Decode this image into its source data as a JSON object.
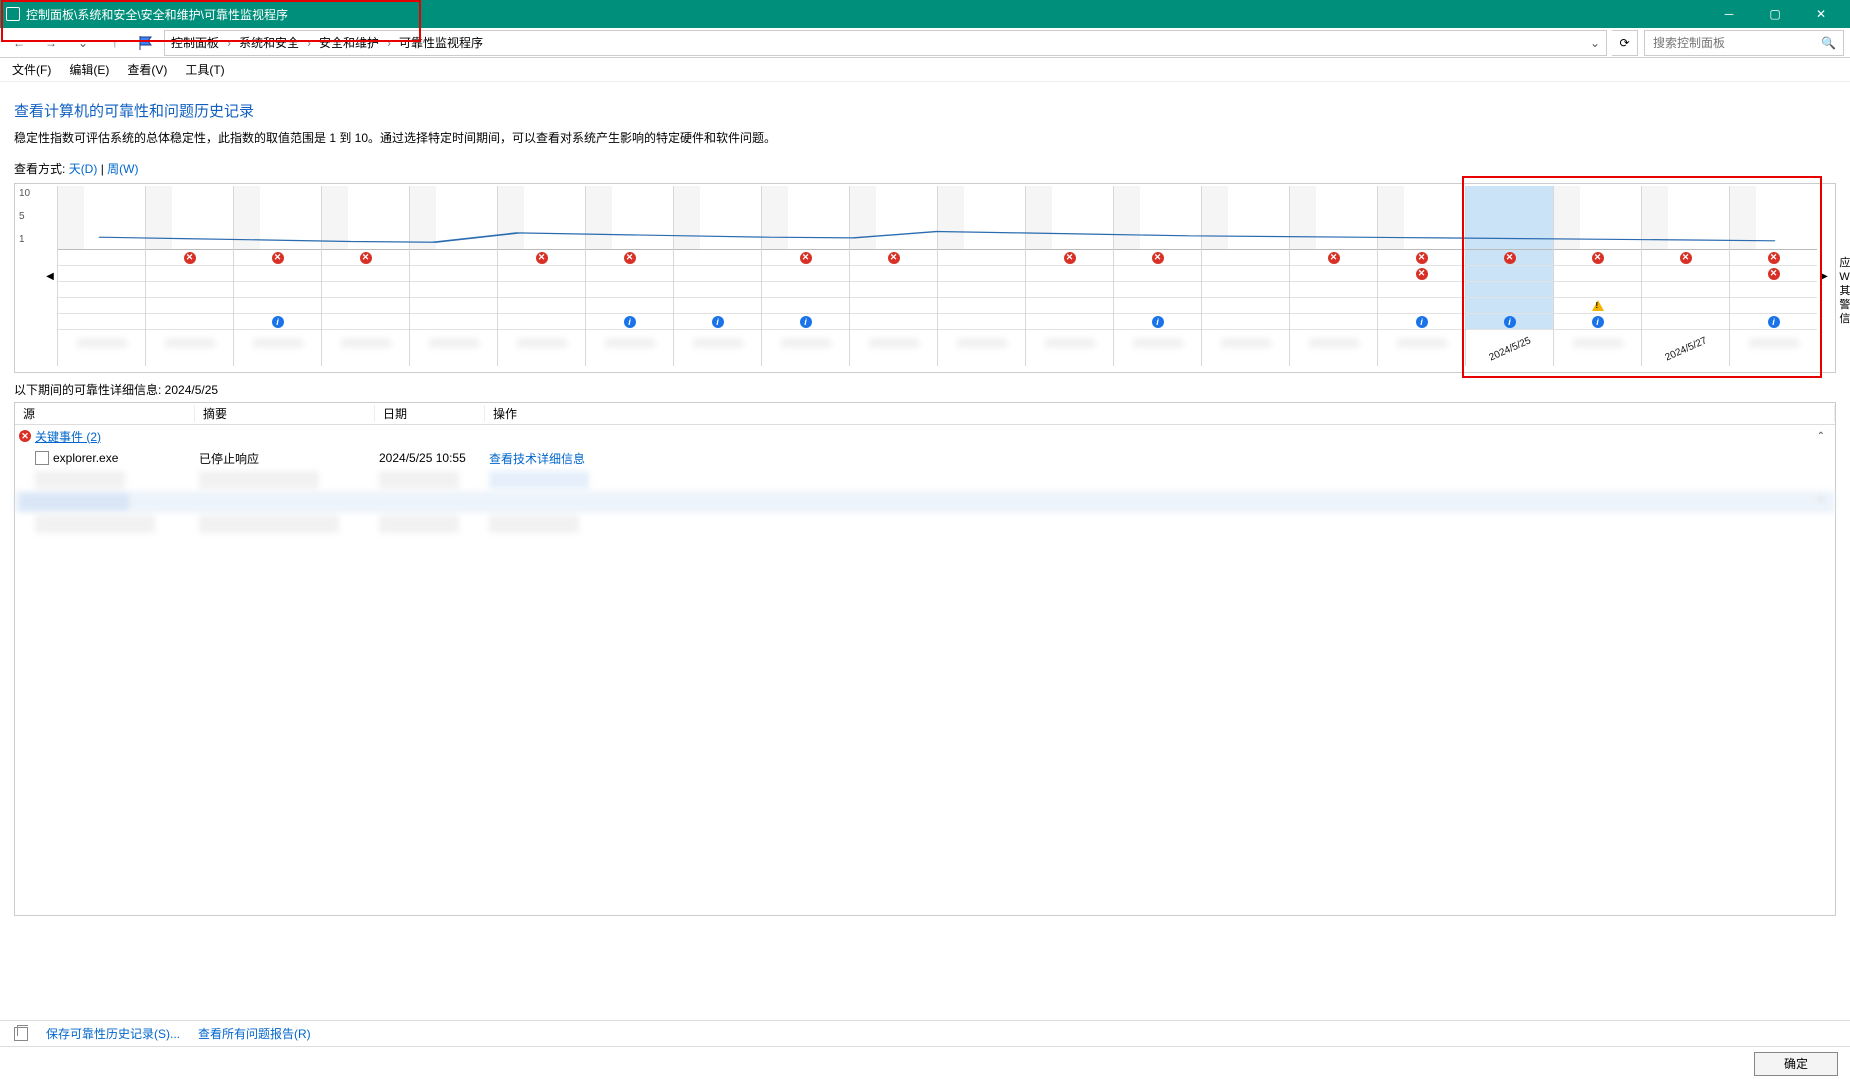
{
  "window": {
    "title": "控制面板\\系统和安全\\安全和维护\\可靠性监视程序"
  },
  "breadcrumb": {
    "items": [
      "控制面板",
      "系统和安全",
      "安全和维护",
      "可靠性监视程序"
    ]
  },
  "search": {
    "placeholder": "搜索控制面板"
  },
  "menubar": {
    "file": "文件(F)",
    "edit": "编辑(E)",
    "view": "查看(V)",
    "tools": "工具(T)"
  },
  "page": {
    "heading": "查看计算机的可靠性和问题历史记录",
    "description": "稳定性指数可评估系统的总体稳定性，此指数的取值范围是 1 到 10。通过选择特定时间期间，可以查看对系统产生影响的特定硬件和软件问题。",
    "view_by_label": "查看方式:",
    "view_by_day": "天(D)",
    "view_by_week": "周(W)",
    "separator": " | "
  },
  "chart_data": {
    "type": "line",
    "ylim": [
      1,
      10
    ],
    "ytick_labels": [
      "10",
      "5",
      "1"
    ],
    "row_labels": [
      "应用程序故障",
      "Windows 故障",
      "其他故障",
      "警告",
      "信息"
    ],
    "dates_visible": [
      "2024/5/25",
      "2024/5/27"
    ],
    "line_y": [
      2.8,
      2.6,
      2.4,
      2.2,
      2.1,
      3.4,
      3.2,
      3.0,
      2.8,
      2.7,
      3.6,
      3.4,
      3.2,
      3.0,
      2.9,
      2.8,
      2.7,
      2.6,
      2.5,
      2.4,
      2.3
    ],
    "columns": [
      {
        "app": false,
        "win": false,
        "other": false,
        "warn": false,
        "info": false,
        "date": ""
      },
      {
        "app": true,
        "win": false,
        "other": false,
        "warn": false,
        "info": false,
        "date": ""
      },
      {
        "app": true,
        "win": false,
        "other": false,
        "warn": false,
        "info": true,
        "date": ""
      },
      {
        "app": true,
        "win": false,
        "other": false,
        "warn": false,
        "info": false,
        "date": ""
      },
      {
        "app": false,
        "win": false,
        "other": false,
        "warn": false,
        "info": false,
        "date": ""
      },
      {
        "app": true,
        "win": false,
        "other": false,
        "warn": false,
        "info": false,
        "date": ""
      },
      {
        "app": true,
        "win": false,
        "other": false,
        "warn": false,
        "info": true,
        "date": ""
      },
      {
        "app": false,
        "win": false,
        "other": false,
        "warn": false,
        "info": true,
        "date": ""
      },
      {
        "app": true,
        "win": false,
        "other": false,
        "warn": false,
        "info": true,
        "date": ""
      },
      {
        "app": true,
        "win": false,
        "other": false,
        "warn": false,
        "info": false,
        "date": ""
      },
      {
        "app": false,
        "win": false,
        "other": false,
        "warn": false,
        "info": false,
        "date": ""
      },
      {
        "app": true,
        "win": false,
        "other": false,
        "warn": false,
        "info": false,
        "date": ""
      },
      {
        "app": true,
        "win": false,
        "other": false,
        "warn": false,
        "info": true,
        "date": ""
      },
      {
        "app": false,
        "win": false,
        "other": false,
        "warn": false,
        "info": false,
        "date": ""
      },
      {
        "app": true,
        "win": false,
        "other": false,
        "warn": false,
        "info": false,
        "date": ""
      },
      {
        "app": true,
        "win": true,
        "other": false,
        "warn": false,
        "info": true,
        "date": ""
      },
      {
        "app": true,
        "win": false,
        "other": false,
        "warn": false,
        "info": true,
        "date": "2024/5/25",
        "highlight": true
      },
      {
        "app": true,
        "win": false,
        "other": false,
        "warn": true,
        "info": true,
        "date": ""
      },
      {
        "app": true,
        "win": false,
        "other": false,
        "warn": false,
        "info": false,
        "date": "2024/5/27"
      },
      {
        "app": true,
        "win": true,
        "other": false,
        "warn": false,
        "info": true,
        "date": ""
      }
    ]
  },
  "details": {
    "period_label": "以下期间的可靠性详细信息: 2024/5/25",
    "columns": {
      "source": "源",
      "summary": "摘要",
      "date": "日期",
      "action": "操作"
    },
    "group_critical": "关键事件 (2)",
    "rows": [
      {
        "source": "explorer.exe",
        "summary": "已停止响应",
        "date": "2024/5/25 10:55",
        "action": "查看技术详细信息"
      }
    ]
  },
  "footer": {
    "save_history": "保存可靠性历史记录(S)...",
    "view_all": "查看所有问题报告(R)",
    "ok": "确定"
  }
}
